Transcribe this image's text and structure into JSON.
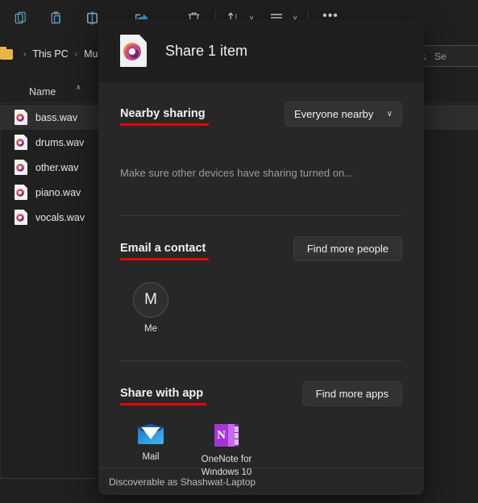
{
  "explorer": {
    "toolbar": {
      "buttons": [
        {
          "name": "copy-button",
          "icon": "copy-icon",
          "label": "Copy"
        },
        {
          "name": "paste-button",
          "icon": "paste-icon",
          "label": "Paste"
        },
        {
          "name": "rename-button",
          "icon": "rename-icon",
          "label": "Rename"
        },
        {
          "name": "share-button",
          "icon": "share-icon",
          "label": "Share"
        },
        {
          "name": "delete-button",
          "icon": "trash-icon",
          "label": "Delete"
        },
        {
          "name": "sort-button",
          "icon": "sort-icon",
          "label": "Sort"
        },
        {
          "name": "view-button",
          "icon": "view-lines-icon",
          "label": "View"
        },
        {
          "name": "more-button",
          "icon": "ellipsis-icon",
          "label": "See more"
        }
      ],
      "ellipsis": "•••",
      "chevron": "∨"
    },
    "breadcrumb": {
      "separator": "›",
      "items": [
        "This PC",
        "Music"
      ]
    },
    "search": {
      "placeholder": "Se",
      "icon": "search-icon"
    },
    "columns": {
      "name_header": "Name",
      "sort_arrow": "∧"
    },
    "files": [
      {
        "name": "bass.wav",
        "selected": true
      },
      {
        "name": "drums.wav",
        "selected": false
      },
      {
        "name": "other.wav",
        "selected": false
      },
      {
        "name": "piano.wav",
        "selected": false
      },
      {
        "name": "vocals.wav",
        "selected": false
      }
    ]
  },
  "share_dialog": {
    "title": "Share 1 item",
    "file_icon": "audio-file-icon",
    "nearby": {
      "section_title": "Nearby sharing",
      "dropdown_value": "Everyone nearby",
      "dropdown_chevron": "∨",
      "hint": "Make sure other devices have sharing turned on..."
    },
    "email": {
      "section_title": "Email a contact",
      "action_label": "Find more people",
      "contacts": [
        {
          "initial": "M",
          "name": "Me"
        }
      ]
    },
    "apps": {
      "section_title": "Share with app",
      "action_label": "Find more apps",
      "items": [
        {
          "name": "Mail",
          "icon": "mail-icon"
        },
        {
          "name": "OneNote for Windows 10",
          "icon": "onenote-icon"
        }
      ]
    },
    "footer": {
      "discoverable_text": "Discoverable as Shashwat-Laptop"
    }
  },
  "colors": {
    "window_bg": "#202020",
    "dialog_bg": "#272727",
    "dialog_header_bg": "#1f1f1f",
    "annotation_red": "#ee0000",
    "accent_blue": "#3aa0e0",
    "onenote_purple": "#a635d6"
  }
}
